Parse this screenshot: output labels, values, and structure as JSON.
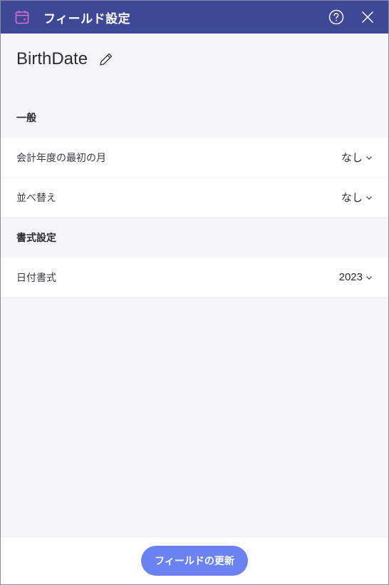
{
  "dialog": {
    "title": "フィールド設定",
    "icons": {
      "title_icon": "calendar-icon",
      "help": "help-circle-icon",
      "close": "close-icon"
    }
  },
  "field": {
    "name": "BirthDate",
    "edit_icon": "pencil-icon"
  },
  "sections": {
    "general": {
      "label": "一般",
      "rows": [
        {
          "label": "会計年度の最初の月",
          "value": "なし"
        },
        {
          "label": "並べ替え",
          "value": "なし"
        }
      ]
    },
    "format": {
      "label": "書式設定",
      "rows": [
        {
          "label": "日付書式",
          "value": "2023"
        }
      ]
    }
  },
  "footer": {
    "update_label": "フィールドの更新"
  },
  "colors": {
    "titlebar": "#3f4896",
    "title_icon": "#d86fd0",
    "accent_button": "#6b82f2",
    "background": "#f5f6fa"
  }
}
